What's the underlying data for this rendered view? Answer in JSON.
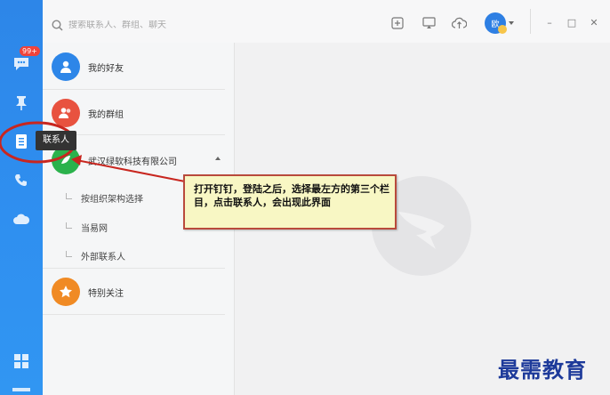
{
  "sidebar": {
    "items": [
      {
        "icon": "chat-icon",
        "badge": "99+"
      },
      {
        "icon": "pin-icon"
      },
      {
        "icon": "contacts-icon"
      },
      {
        "icon": "phone-icon"
      },
      {
        "icon": "cloud-icon"
      },
      {
        "icon": "apps-grid-icon"
      }
    ],
    "tooltip": "联系人"
  },
  "search": {
    "placeholder": "搜索联系人、群组、聊天"
  },
  "toolbar": {
    "icons": [
      "add-icon",
      "screen-share-icon",
      "upload-cloud-icon"
    ],
    "avatar_text": "欧"
  },
  "window": {
    "minimize": "–",
    "maximize": "□",
    "close": "✕"
  },
  "contacts": {
    "my_friends": "我的好友",
    "my_groups": "我的群组",
    "company": "武汉绿软科技有限公司",
    "sub_items": [
      "按组织架构选择",
      "当易网",
      "外部联系人"
    ],
    "special": "特别关注"
  },
  "annotation": {
    "callout": "打开钉钉，登陆之后，选择最左方的第三个栏目，点击联系人，会出现此界面"
  },
  "watermark": "最需教育",
  "colors": {
    "sidebar": "#2f8ff0",
    "accent_blue": "#2d86e8",
    "red": "#e8523f",
    "orange": "#f08a24",
    "green": "#2bb24c",
    "callout_border": "#b94a3c"
  }
}
